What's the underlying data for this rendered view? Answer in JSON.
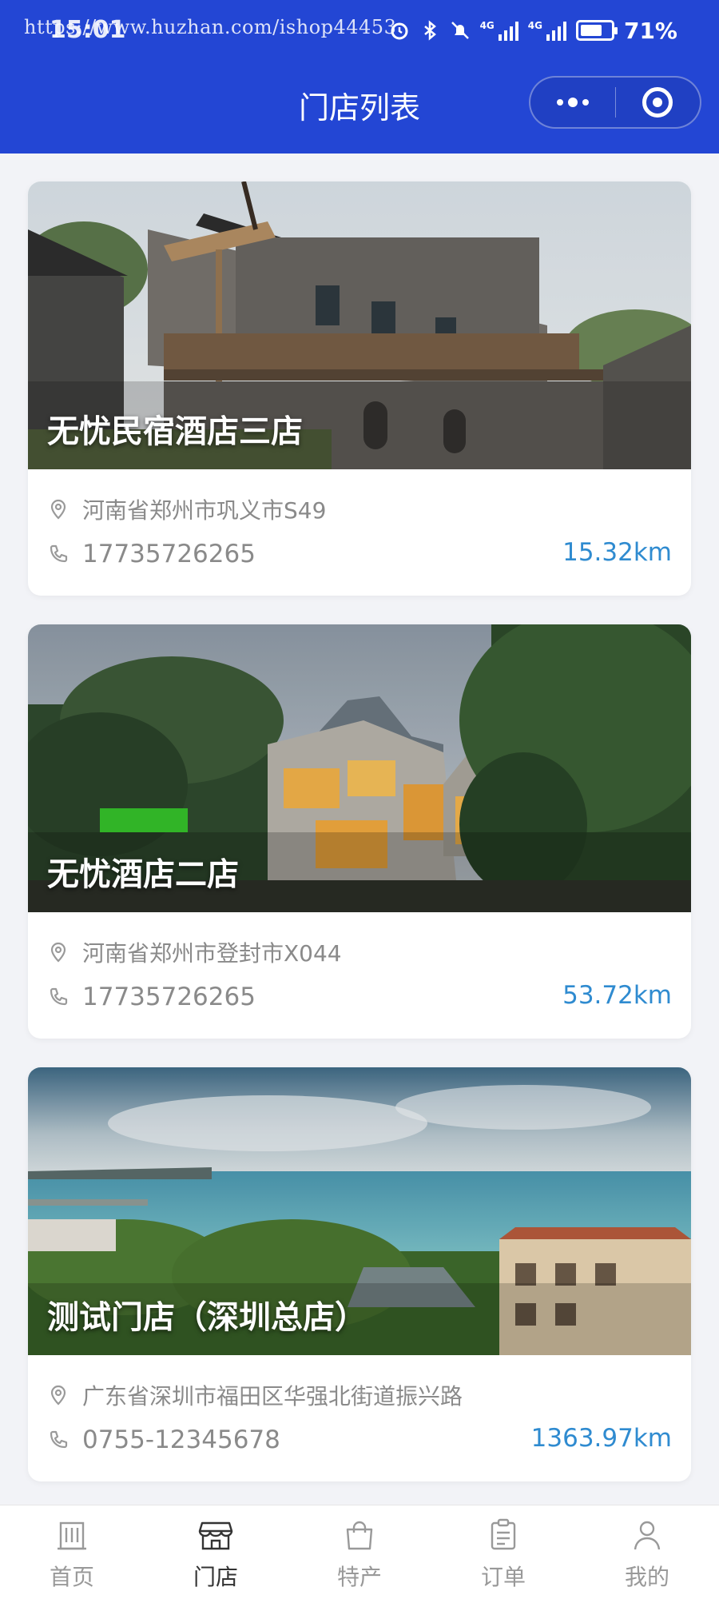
{
  "status_bar": {
    "watermark": "https://www.huzhan.com/ishop44453",
    "time": "15:01",
    "battery": "71%",
    "battery_level": 0.71
  },
  "header": {
    "title": "门店列表"
  },
  "stores": [
    {
      "name": "无忧民宿酒店三店",
      "address": "河南省郑州市巩义市S49",
      "phone": "17735726265",
      "distance": "15.32km"
    },
    {
      "name": "无忧酒店二店",
      "address": "河南省郑州市登封市X044",
      "phone": "17735726265",
      "distance": "53.72km"
    },
    {
      "name": "测试门店（深圳总店）",
      "address": "广东省深圳市福田区华强北街道振兴路",
      "phone": "0755-12345678",
      "distance": "1363.97km"
    }
  ],
  "tabbar": {
    "items": [
      {
        "label": "首页",
        "icon": "home-building-icon"
      },
      {
        "label": "门店",
        "icon": "store-icon"
      },
      {
        "label": "特产",
        "icon": "shopping-bag-icon"
      },
      {
        "label": "订单",
        "icon": "clipboard-icon"
      },
      {
        "label": "我的",
        "icon": "user-icon"
      }
    ],
    "active_index": 1
  },
  "colors": {
    "header_bg": "#2346d4",
    "distance": "#2f8bd0",
    "page_bg": "#f2f3f7"
  }
}
